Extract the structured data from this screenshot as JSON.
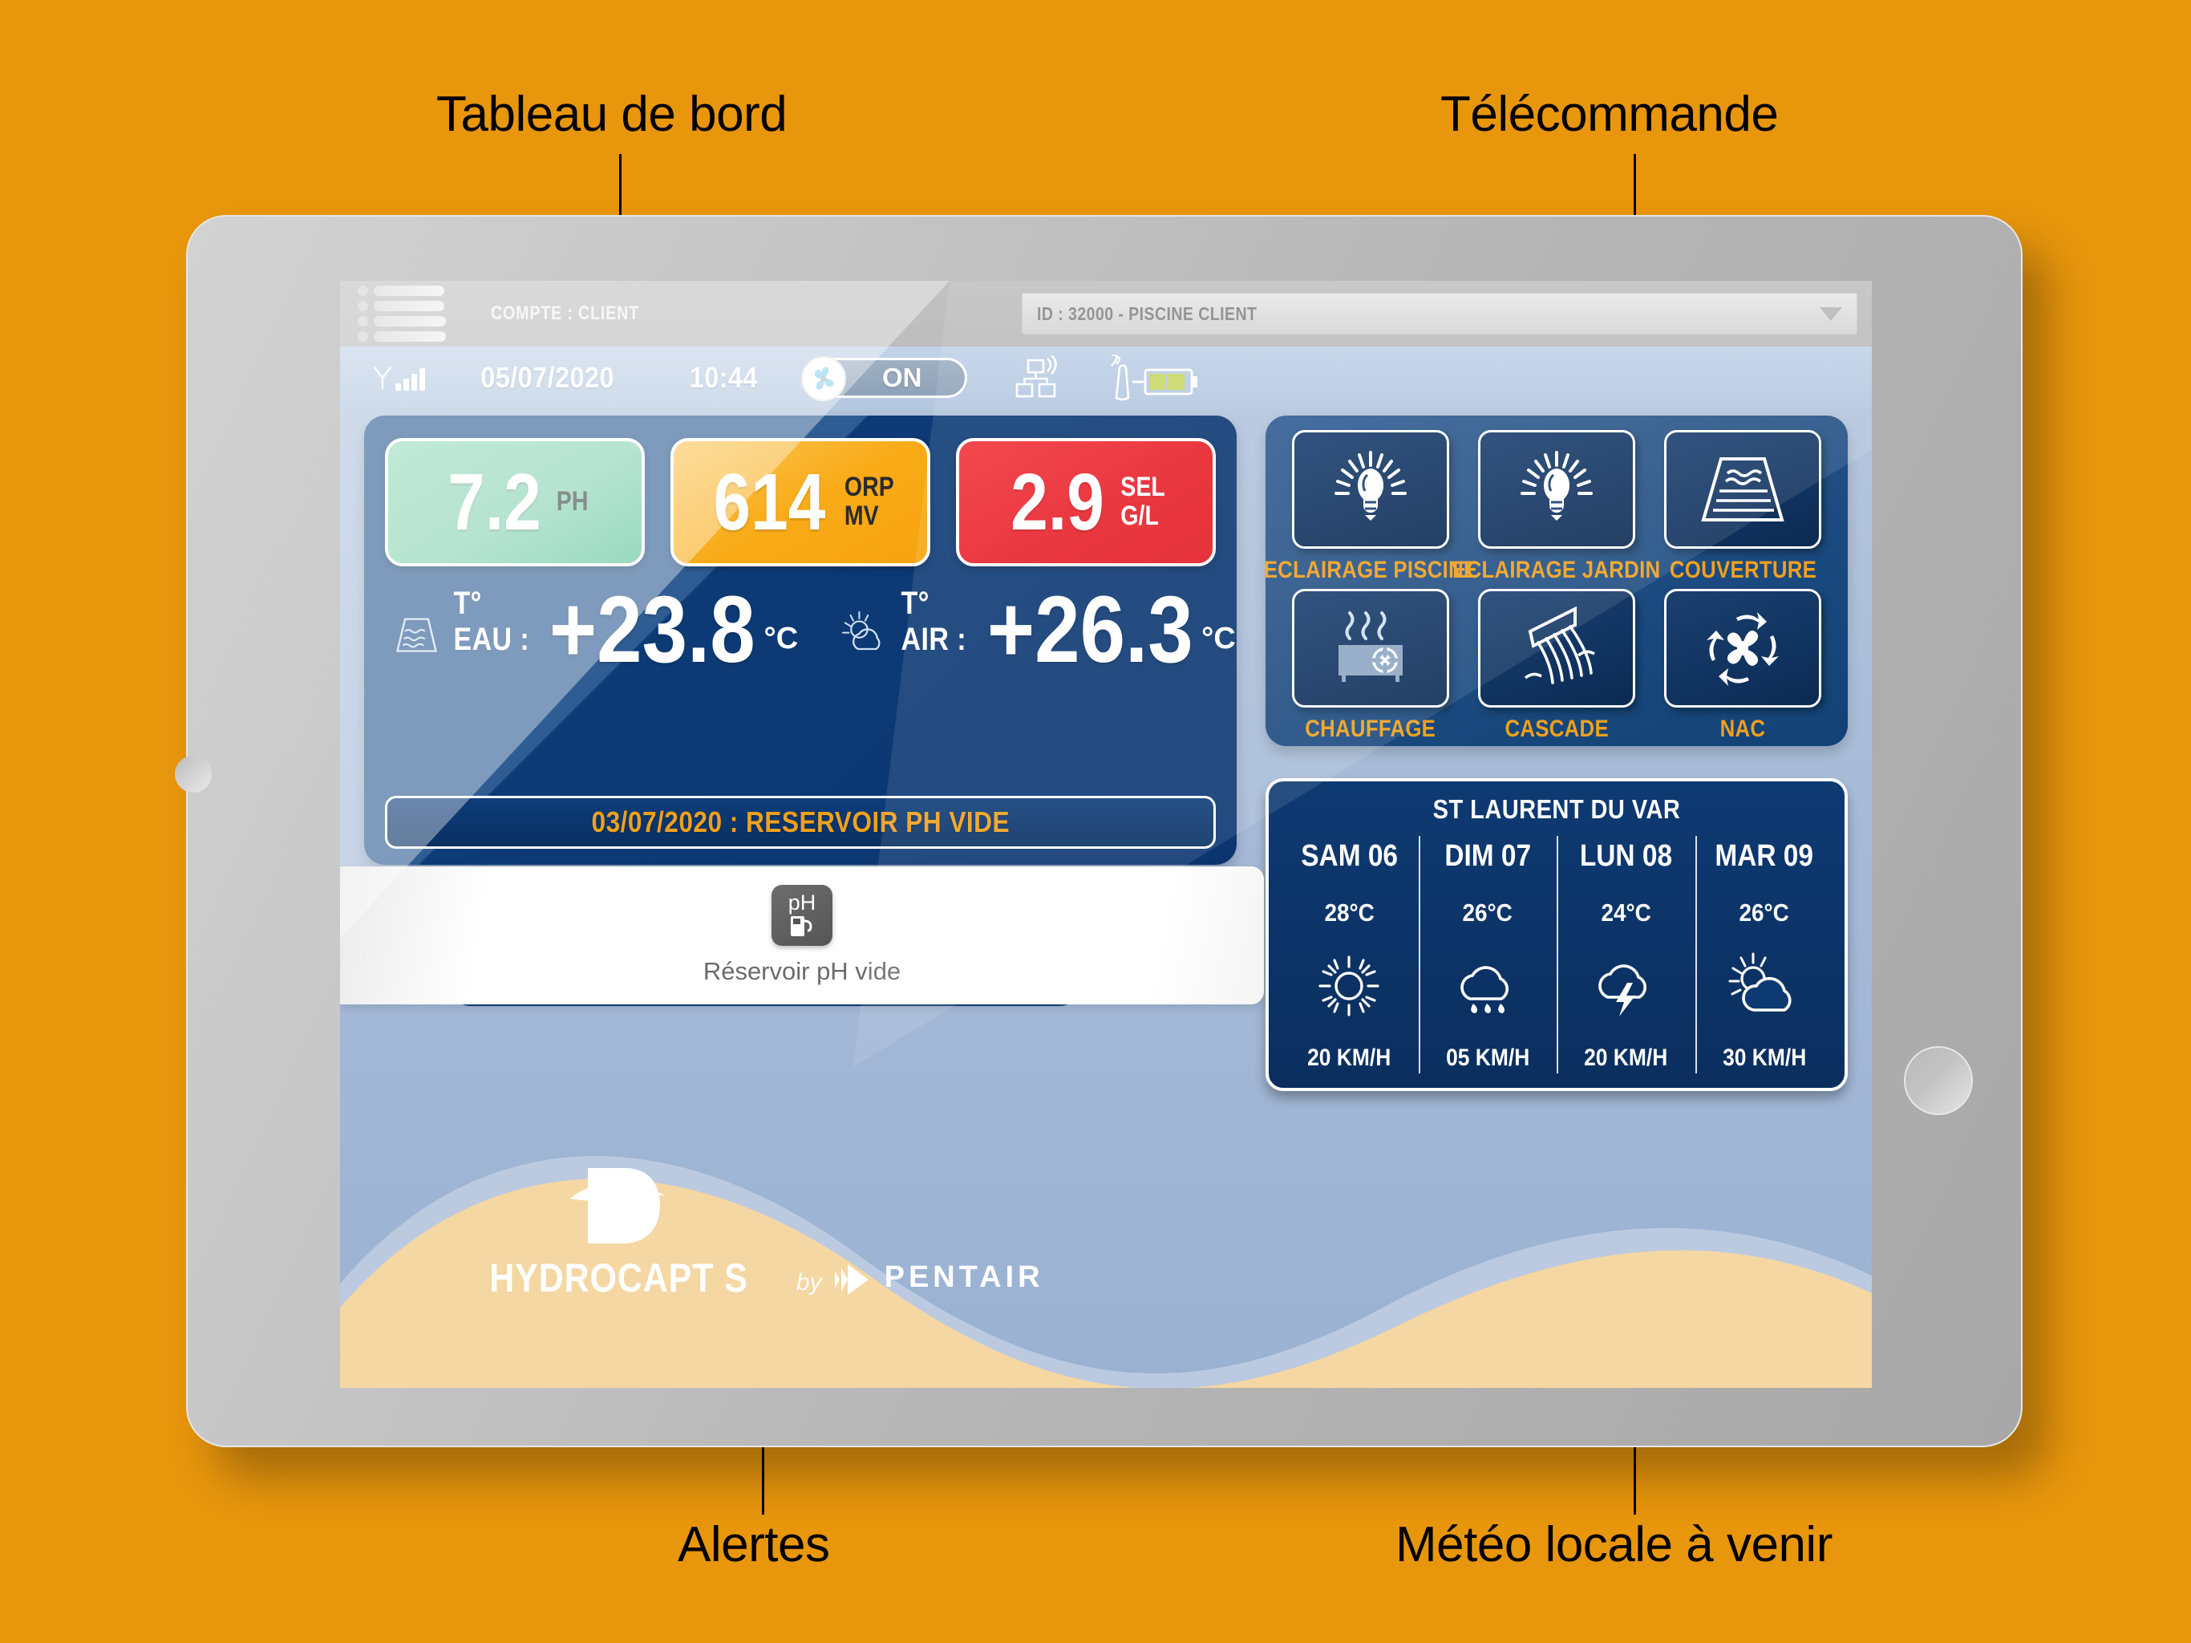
{
  "callouts": {
    "dashboard": "Tableau de bord",
    "remote": "Télécommande",
    "alerts": "Alertes",
    "weather": "Météo locale à venir"
  },
  "app_header": {
    "account_label": "COMPTE : CLIENT",
    "site_select_value": "ID : 32000 - PISCINE CLIENT"
  },
  "status_bar": {
    "date": "05/07/2020",
    "time": "10:44",
    "filtration_state": "ON",
    "icons": [
      "signal-icon",
      "fan-icon",
      "network-icon",
      "probe-icon",
      "battery-icon"
    ]
  },
  "measurements": [
    {
      "value": "7.2",
      "unit_line1": "PH",
      "unit_line2": "",
      "color": "#8ad3b4",
      "name": "ph"
    },
    {
      "value": "614",
      "unit_line1": "ORP",
      "unit_line2": "MV",
      "color": "#f9ab17",
      "name": "orp"
    },
    {
      "value": "2.9",
      "unit_line1": "SEL",
      "unit_line2": "G/L",
      "color": "#e8222c",
      "name": "sel"
    }
  ],
  "temperatures": {
    "water": {
      "label": "T° EAU :",
      "value": "+23.8",
      "unit": "°C",
      "icon": "pool-icon"
    },
    "air": {
      "label": "T° AIR :",
      "value": "+26.3",
      "unit": "°C",
      "icon": "sun-cloud-icon"
    }
  },
  "dashboard_alert": "03/07/2020 : RESERVOIR PH VIDE",
  "remote_buttons": [
    {
      "label": "ECLAIRAGE PISCINE",
      "icon": "lightbulb-icon"
    },
    {
      "label": "ECLAIRAGE JARDIN",
      "icon": "lightbulb-icon"
    },
    {
      "label": "COUVERTURE",
      "icon": "pool-cover-icon"
    },
    {
      "label": "CHAUFFAGE",
      "icon": "heat-pump-icon"
    },
    {
      "label": "CASCADE",
      "icon": "waterfall-icon"
    },
    {
      "label": "NAC",
      "icon": "robot-cleaner-icon"
    }
  ],
  "weather": {
    "city": "ST LAURENT DU VAR",
    "days": [
      {
        "day": "SAM 06",
        "temp": "28°C",
        "wind": "20 KM/H",
        "icon": "sun-icon"
      },
      {
        "day": "DIM 07",
        "temp": "26°C",
        "wind": "05 KM/H",
        "icon": "rain-icon"
      },
      {
        "day": "LUN 08",
        "temp": "24°C",
        "wind": "20 KM/H",
        "icon": "storm-icon"
      },
      {
        "day": "MAR 09",
        "temp": "26°C",
        "wind": "30 KM/H",
        "icon": "sun-cloud-icon"
      }
    ]
  },
  "alert_popup": {
    "icon_label": "pH",
    "icon": "ph-tank-icon",
    "message": "Réservoir pH vide"
  },
  "branding": {
    "product": "HYDROCAPT S",
    "by": "by",
    "company": "PENTAIR",
    "logo": "d-logo-icon"
  },
  "colors": {
    "page_background": "#E8960C",
    "panel_blue": "#0d3b76",
    "accent_orange": "#F0A01E",
    "screen_blue": "#a8bcd8",
    "sand": "#f5d7a3"
  }
}
